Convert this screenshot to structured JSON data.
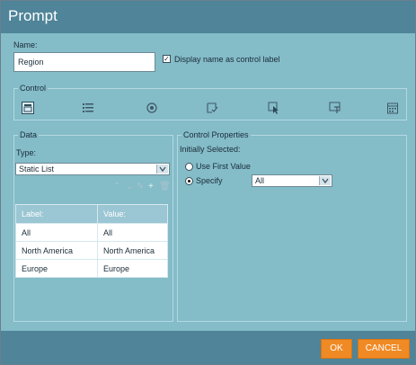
{
  "dialog": {
    "title": "Prompt",
    "name_label": "Name:",
    "name_value": "Region",
    "display_name_checkbox_label": "Display name as control label",
    "display_name_checked": true
  },
  "control": {
    "label": "Control",
    "icons": [
      "dropdown-icon",
      "list-icon",
      "radio-icon",
      "checkbox-icon",
      "pointer-icon",
      "text-field-icon",
      "calendar-icon"
    ],
    "selected_icon": "dropdown-icon"
  },
  "data": {
    "label": "Data",
    "type_label": "Type:",
    "type_value": "Static List",
    "toolbar_icons": [
      "move-up-icon",
      "move-down-icon",
      "edit-icon",
      "add-icon",
      "delete-icon"
    ],
    "columns": [
      "Label:",
      "Value:"
    ],
    "rows": [
      [
        "All",
        "All"
      ],
      [
        "North America",
        "North America"
      ],
      [
        "Europe",
        "Europe"
      ]
    ]
  },
  "control_properties": {
    "label": "Control Properties",
    "initially_selected_label": "Initially Selected:",
    "use_first_value_label": "Use First Value",
    "specify_label": "Specify",
    "specify_selected": true,
    "specify_value": "All"
  },
  "footer": {
    "ok_label": "OK",
    "cancel_label": "CANCEL"
  },
  "colors": {
    "titlebar": "#4f8499",
    "body": "#84bcc8",
    "accent_button": "#f08a24"
  }
}
